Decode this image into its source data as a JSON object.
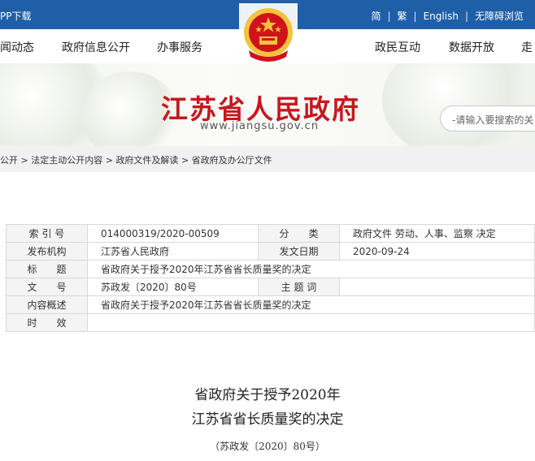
{
  "topbar": {
    "app_download": "PP下载",
    "links": [
      "简",
      "繁",
      "English",
      "无障碍浏览"
    ],
    "separator": "|"
  },
  "nav": {
    "items": [
      "闻动态",
      "政府信息公开",
      "办事服务",
      "政民互动",
      "数据开放",
      "走"
    ]
  },
  "banner": {
    "title": "江苏省人民政府",
    "url": "www.jiangsu.gov.cn"
  },
  "search": {
    "placeholder": "-请输入要搜索的关"
  },
  "breadcrumb": {
    "items": [
      "公开",
      "法定主动公开内容",
      "政府文件及解读",
      "省政府及办公厅文件"
    ],
    "separator": ">"
  },
  "meta": {
    "rows": [
      [
        "索 引 号",
        "014000319/2020-00509",
        "分　　类",
        "政府文件 劳动、人事、监察 决定"
      ],
      [
        "发布机构",
        "江苏省人民政府",
        "发文日期",
        "2020-09-24"
      ],
      [
        "标　　题",
        "省政府关于授予2020年江苏省省长质量奖的决定"
      ],
      [
        "文　　号",
        "苏政发〔2020〕80号",
        "主 题 词",
        ""
      ],
      [
        "内容概述",
        "省政府关于授予2020年江苏省省长质量奖的决定"
      ],
      [
        "时　　效",
        ""
      ]
    ]
  },
  "document": {
    "title_line1": "省政府关于授予2020年",
    "title_line2": "江苏省省长质量奖的决定",
    "doc_number": "（苏政发〔2020〕80号）"
  },
  "colors": {
    "topbar": "#1f5fa8",
    "title_red": "#c8171e",
    "emblem_red": "#d0121b",
    "emblem_gold": "#f3c33b"
  }
}
